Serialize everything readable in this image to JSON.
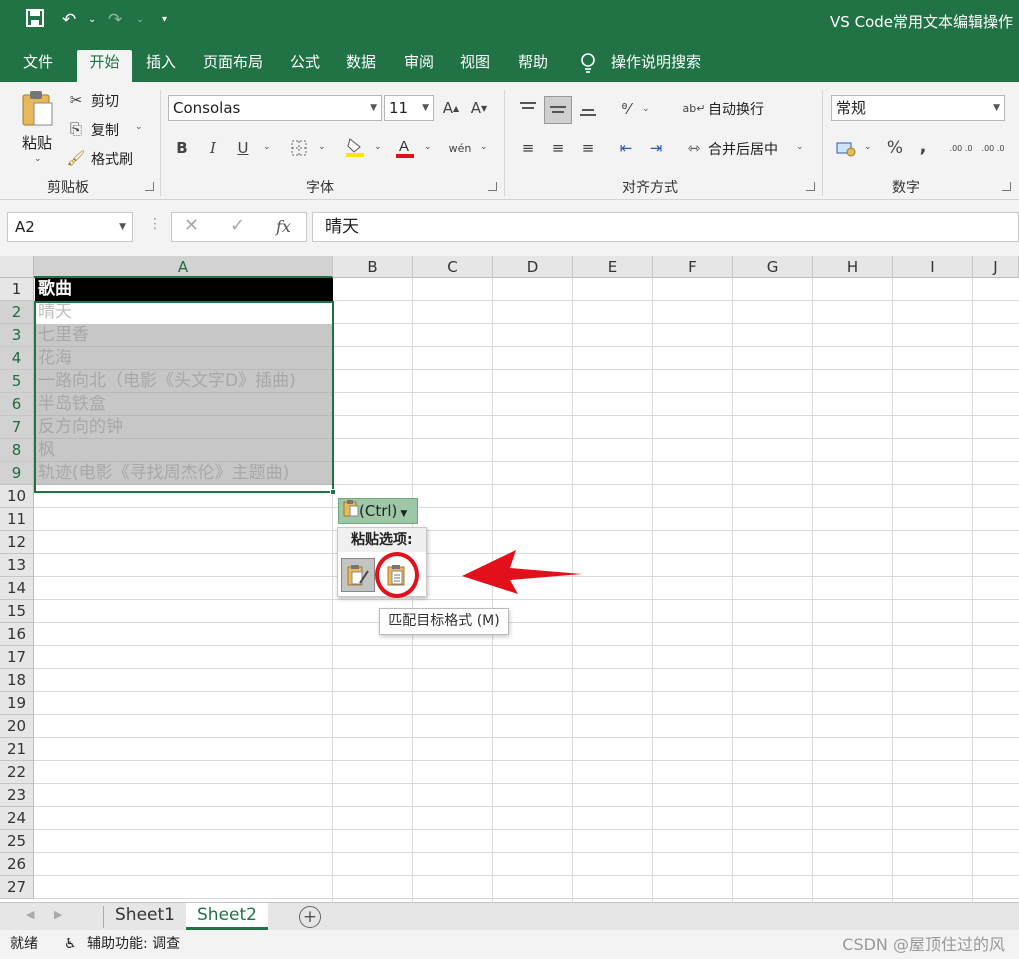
{
  "title_bar": {
    "title": "VS Code常用文本编辑操作"
  },
  "menu": {
    "tabs": [
      "文件",
      "开始",
      "插入",
      "页面布局",
      "公式",
      "数据",
      "审阅",
      "视图",
      "帮助",
      "操作说明搜索"
    ],
    "active": "开始"
  },
  "ribbon": {
    "clipboard": {
      "paste": "粘贴",
      "cut": "剪切",
      "copy": "复制",
      "format_painter": "格式刷",
      "title": "剪贴板"
    },
    "font": {
      "name": "Consolas",
      "size": "11",
      "bold": "B",
      "italic": "I",
      "underline": "U",
      "title": "字体"
    },
    "alignment": {
      "wrap": "自动换行",
      "merge": "合并后居中",
      "title": "对齐方式"
    },
    "number": {
      "format": "常规",
      "percent": "%",
      "comma": ",",
      "inc_decimal": ".00 .0",
      "dec_decimal": ".00 .0",
      "title": "数字"
    }
  },
  "formula_bar": {
    "name_box": "A2",
    "fx": "fx",
    "content": "晴天"
  },
  "columns": [
    "A",
    "B",
    "C",
    "D",
    "E",
    "F",
    "G",
    "H",
    "I",
    "J"
  ],
  "rows": [
    "1",
    "2",
    "3",
    "4",
    "5",
    "6",
    "7",
    "8",
    "9",
    "10",
    "11",
    "12",
    "13",
    "14",
    "15",
    "16",
    "17",
    "18",
    "19",
    "20",
    "21",
    "22",
    "23",
    "24",
    "25",
    "26",
    "27"
  ],
  "cells_a": [
    "歌曲",
    "晴天",
    "七里香",
    "花海",
    "一路向北（电影《头文字D》插曲)",
    "半岛铁盒",
    "反方向的钟",
    "枫",
    "轨迹(电影《寻找周杰伦》主题曲)"
  ],
  "paste": {
    "button": "(Ctrl)",
    "panel_title": "粘贴选项:",
    "tooltip": "匹配目标格式 (M)"
  },
  "sheets": {
    "tabs": [
      "Sheet1",
      "Sheet2"
    ],
    "active": "Sheet2"
  },
  "status": {
    "ready": "就绪",
    "accessibility": "辅助功能: 调查",
    "watermark": "CSDN @屋顶住过的风"
  },
  "colors": {
    "accent": "#217346",
    "annotation": "#e3101c"
  }
}
